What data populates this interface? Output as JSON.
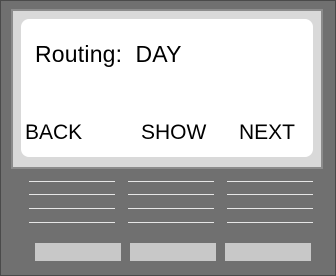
{
  "display": {
    "title": "Routing:  DAY",
    "softkeys": [
      {
        "label": "BACK"
      },
      {
        "label": "SHOW"
      },
      {
        "label": "NEXT"
      }
    ]
  }
}
